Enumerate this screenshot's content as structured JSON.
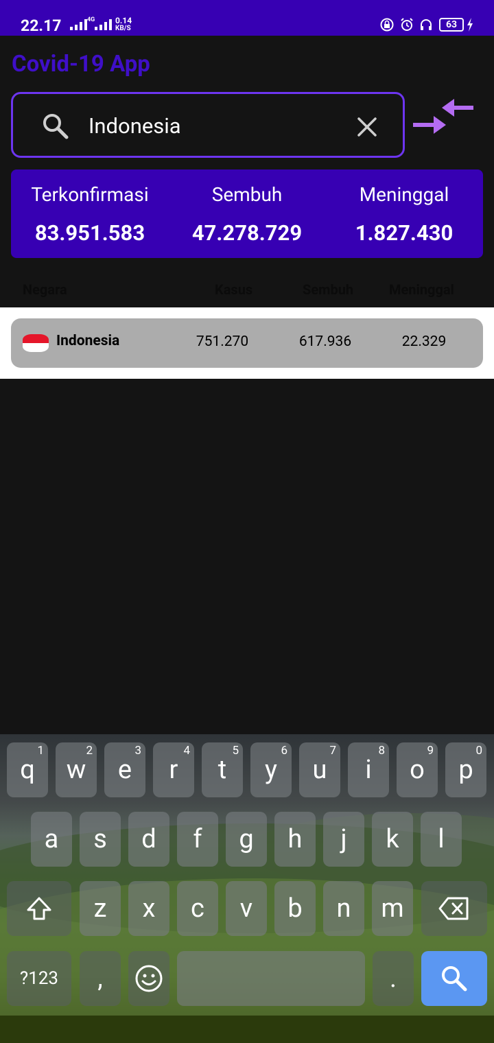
{
  "status_bar": {
    "time": "22.17",
    "network_type": "4G",
    "speed_value": "0.14",
    "speed_unit": "KB/S",
    "battery": "63"
  },
  "app": {
    "title": "Covid-19 App"
  },
  "search": {
    "value": "Indonesia",
    "placeholder": ""
  },
  "summary": {
    "confirmed_label": "Terkonfirmasi",
    "confirmed_value": "83.951.583",
    "recovered_label": "Sembuh",
    "recovered_value": "47.278.729",
    "deaths_label": "Meninggal",
    "deaths_value": "1.827.430"
  },
  "table": {
    "headers": [
      "Negara",
      "Kasus",
      "Sembuh",
      "Meninggal"
    ],
    "rows": [
      {
        "country": "Indonesia",
        "cases": "751.270",
        "recovered": "617.936",
        "deaths": "22.329"
      }
    ]
  },
  "keyboard": {
    "row1": [
      {
        "k": "q",
        "h": "1"
      },
      {
        "k": "w",
        "h": "2"
      },
      {
        "k": "e",
        "h": "3"
      },
      {
        "k": "r",
        "h": "4"
      },
      {
        "k": "t",
        "h": "5"
      },
      {
        "k": "y",
        "h": "6"
      },
      {
        "k": "u",
        "h": "7"
      },
      {
        "k": "i",
        "h": "8"
      },
      {
        "k": "o",
        "h": "9"
      },
      {
        "k": "p",
        "h": "0"
      }
    ],
    "row2": [
      "a",
      "s",
      "d",
      "f",
      "g",
      "h",
      "j",
      "k",
      "l"
    ],
    "row3": [
      "z",
      "x",
      "c",
      "v",
      "b",
      "n",
      "m"
    ],
    "symbols": "?123",
    "comma": ",",
    "period": "."
  }
}
